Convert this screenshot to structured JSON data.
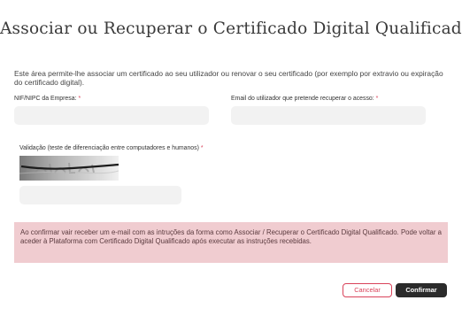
{
  "title": "Associar ou Recuperar o Certificado Digital Qualificado",
  "intro": "Este área permite-lhe associar um certificado ao seu utilizador ou renovar o seu certificado (por exemplo por extravio ou expiração do certificado digital).",
  "required_marker": "*",
  "form": {
    "nif_label": "NIF/NIPC da Empresa:",
    "nif_value": "",
    "user_email_label": "Email do utilizador que pretende recuperar o acesso:",
    "user_email_value": "",
    "captcha_label": "Validação (teste de diferenciação entre computadores e humanos)",
    "captcha_value": ""
  },
  "notice": "Ao confirmar vair receber um e-mail com as intruções da forma como Associar / Recuperar o Certificado Digital Qualificado. Pode voltar a aceder à Plataforma com Certificado Digital Qualificado após executar as instruções recebidas.",
  "buttons": {
    "cancel": "Cancelar",
    "confirm": "Confirmar"
  },
  "colors": {
    "accent": "#d9435a",
    "notice_bg": "#f0ccd0",
    "field_bg": "#f2f2f2",
    "primary_button": "#2b2b2b"
  }
}
